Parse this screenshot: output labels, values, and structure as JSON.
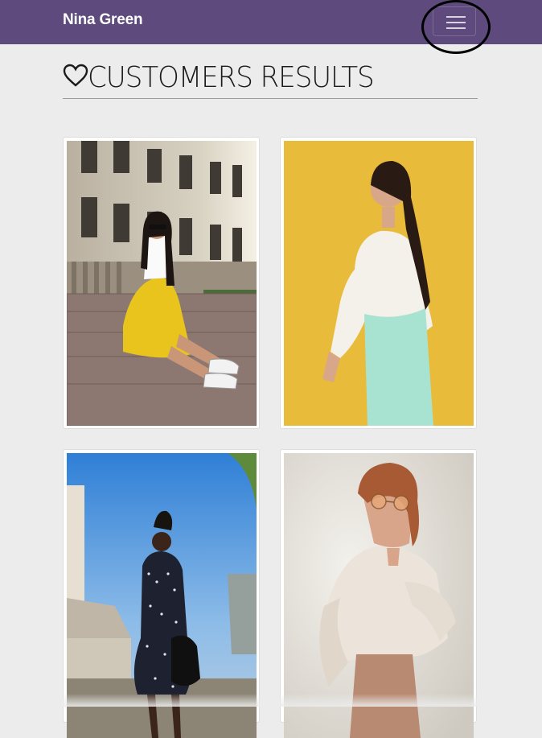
{
  "navbar": {
    "brand": "Nina Green",
    "toggler_icon": "hamburger-menu-icon",
    "color": "#5e4a7d"
  },
  "page": {
    "heart_icon": "heart-outline-icon",
    "title": "CUSTOMERS RESULTS"
  },
  "gallery": {
    "photos": [
      {
        "subject": "woman sitting on stone steps wearing sunglasses, white t-shirt and yellow pleated skirt"
      },
      {
        "subject": "woman in white lace blouse and mint skirt against yellow background"
      },
      {
        "subject": "woman in polka dot dress holding black handbag on city street"
      },
      {
        "subject": "woman in round tinted glasses and oversized beige shirt"
      }
    ]
  }
}
